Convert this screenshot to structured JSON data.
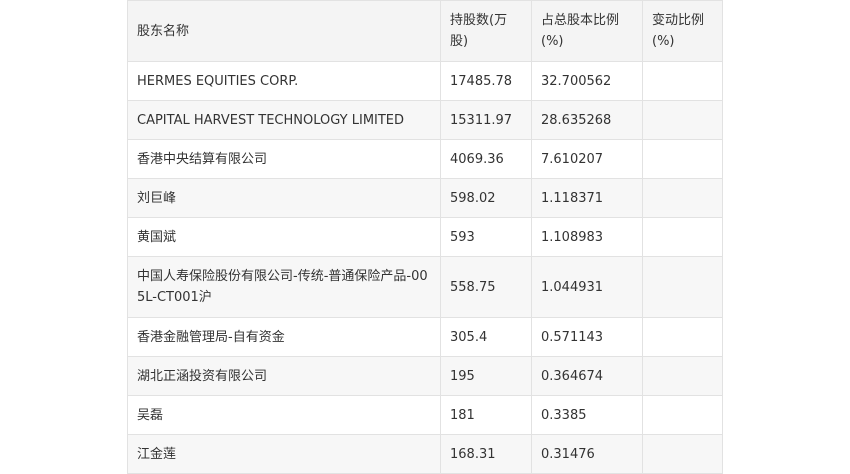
{
  "table": {
    "headers": [
      "股东名称",
      "持股数(万股)",
      "占总股本比例(%)",
      "变动比例(%)"
    ],
    "rows": [
      [
        "HERMES EQUITIES CORP.",
        "17485.78",
        "32.700562",
        ""
      ],
      [
        "CAPITAL HARVEST TECHNOLOGY LIMITED",
        "15311.97",
        "28.635268",
        ""
      ],
      [
        "香港中央结算有限公司",
        "4069.36",
        "7.610207",
        ""
      ],
      [
        "刘巨峰",
        "598.02",
        "1.118371",
        ""
      ],
      [
        "黄国斌",
        "593",
        "1.108983",
        ""
      ],
      [
        "中国人寿保险股份有限公司-传统-普通保险产品-005L-CT001沪",
        "558.75",
        "1.044931",
        ""
      ],
      [
        "香港金融管理局-自有资金",
        "305.4",
        "0.571143",
        ""
      ],
      [
        "湖北正涵投资有限公司",
        "195",
        "0.364674",
        ""
      ],
      [
        "吴磊",
        "181",
        "0.3385",
        ""
      ],
      [
        "江金莲",
        "168.31",
        "0.31476",
        ""
      ]
    ]
  }
}
